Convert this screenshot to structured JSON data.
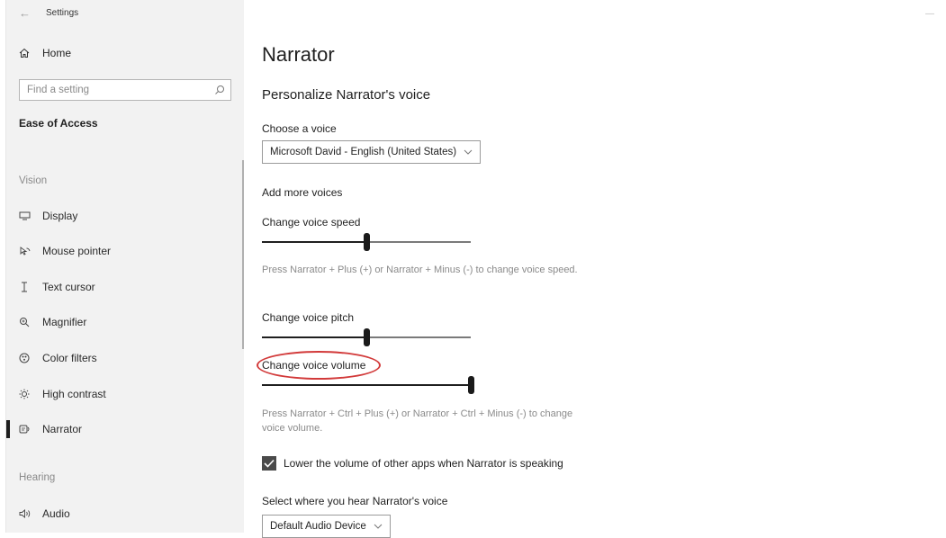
{
  "window": {
    "title": "Settings",
    "minimize": "—"
  },
  "sidebar": {
    "home_label": "Home",
    "search_placeholder": "Find a setting",
    "category": "Ease of Access",
    "sections": [
      {
        "title": "Vision",
        "items": [
          {
            "label": "Display",
            "icon": "display-icon"
          },
          {
            "label": "Mouse pointer",
            "icon": "mouse-pointer-icon"
          },
          {
            "label": "Text cursor",
            "icon": "text-cursor-icon"
          },
          {
            "label": "Magnifier",
            "icon": "magnifier-icon"
          },
          {
            "label": "Color filters",
            "icon": "color-filters-icon"
          },
          {
            "label": "High contrast",
            "icon": "high-contrast-icon"
          },
          {
            "label": "Narrator",
            "icon": "narrator-icon",
            "active": true
          }
        ]
      },
      {
        "title": "Hearing",
        "items": [
          {
            "label": "Audio",
            "icon": "audio-icon"
          }
        ]
      }
    ]
  },
  "main": {
    "title": "Narrator",
    "subheading": "Personalize Narrator's voice",
    "choose_voice_label": "Choose a voice",
    "voice_value": "Microsoft David - English (United States)",
    "add_voices_label": "Add more voices",
    "speed": {
      "label": "Change voice speed",
      "value_fraction": 0.5,
      "hint": "Press Narrator + Plus (+) or Narrator + Minus (-) to change voice speed."
    },
    "pitch": {
      "label": "Change voice pitch",
      "value_fraction": 0.5
    },
    "volume": {
      "label": "Change voice volume",
      "value_fraction": 1.0,
      "hint": "Press Narrator + Ctrl + Plus (+) or Narrator + Ctrl + Minus (-) to change voice volume.",
      "annotation_color": "#d23a3a"
    },
    "lower_volume_checkbox": {
      "label": "Lower the volume of other apps when Narrator is speaking",
      "checked": true
    },
    "output_label": "Select where you hear Narrator's voice",
    "output_value": "Default Audio Device"
  }
}
